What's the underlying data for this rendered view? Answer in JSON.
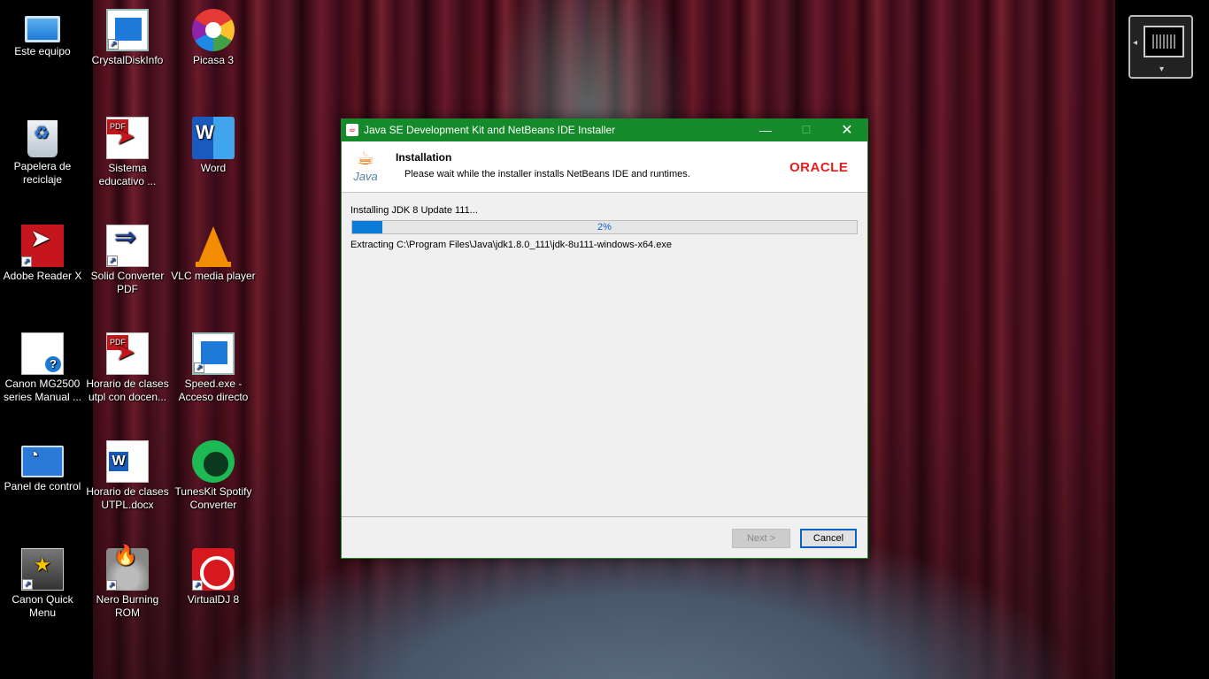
{
  "desktop": {
    "icons": [
      {
        "label": "Este equipo",
        "icon": "computer-icon"
      },
      {
        "label": "CrystalDiskInfo",
        "icon": "crystaldiskinfo-icon"
      },
      {
        "label": "Picasa 3",
        "icon": "picasa-icon"
      },
      {
        "label": "Papelera de\nreciclaje",
        "icon": "recycle-bin-icon"
      },
      {
        "label": "Sistema\neducativo ...",
        "icon": "pdf-icon"
      },
      {
        "label": "Word",
        "icon": "word-icon"
      },
      {
        "label": "Adobe Reader X",
        "icon": "adobe-reader-icon"
      },
      {
        "label": "Solid Converter\nPDF",
        "icon": "solid-converter-icon"
      },
      {
        "label": "VLC media player",
        "icon": "vlc-icon"
      },
      {
        "label": "Canon MG2500\nseries Manual ...",
        "icon": "canon-manual-icon"
      },
      {
        "label": "Horario de clases\nutpl con docen...",
        "icon": "pdf-icon"
      },
      {
        "label": "Speed.exe -\nAcceso directo",
        "icon": "speed-exe-icon"
      },
      {
        "label": "Panel de control",
        "icon": "control-panel-icon"
      },
      {
        "label": "Horario de clases\nUTPL.docx",
        "icon": "word-document-icon"
      },
      {
        "label": "TunesKit Spotify\nConverter",
        "icon": "tuneskit-icon"
      },
      {
        "label": "Canon Quick\nMenu",
        "icon": "canon-quick-menu-icon"
      },
      {
        "label": "Nero Burning\nROM",
        "icon": "nero-icon"
      },
      {
        "label": "VirtualDJ 8",
        "icon": "virtualdj-icon"
      }
    ]
  },
  "installer": {
    "title": "Java SE Development Kit and NetBeans IDE Installer",
    "header_title": "Installation",
    "header_desc": "Please wait while the installer installs NetBeans IDE and runtimes.",
    "java_logo_text": "Java",
    "oracle_logo_text": "ORACLE",
    "status": "Installing JDK 8 Update 111...",
    "progress_label": "2%",
    "progress_fraction": 0.02,
    "detail": "Extracting C:\\Program Files\\Java\\jdk1.8.0_111\\jdk-8u111-windows-x64.exe",
    "next_label": "Next >",
    "cancel_label": "Cancel",
    "min_glyph": "—",
    "max_glyph": "☐",
    "close_glyph": "✕"
  },
  "colors": {
    "titlebar": "#158a2a",
    "progress_fill": "#0a7bd6",
    "oracle_red": "#e2211c"
  }
}
